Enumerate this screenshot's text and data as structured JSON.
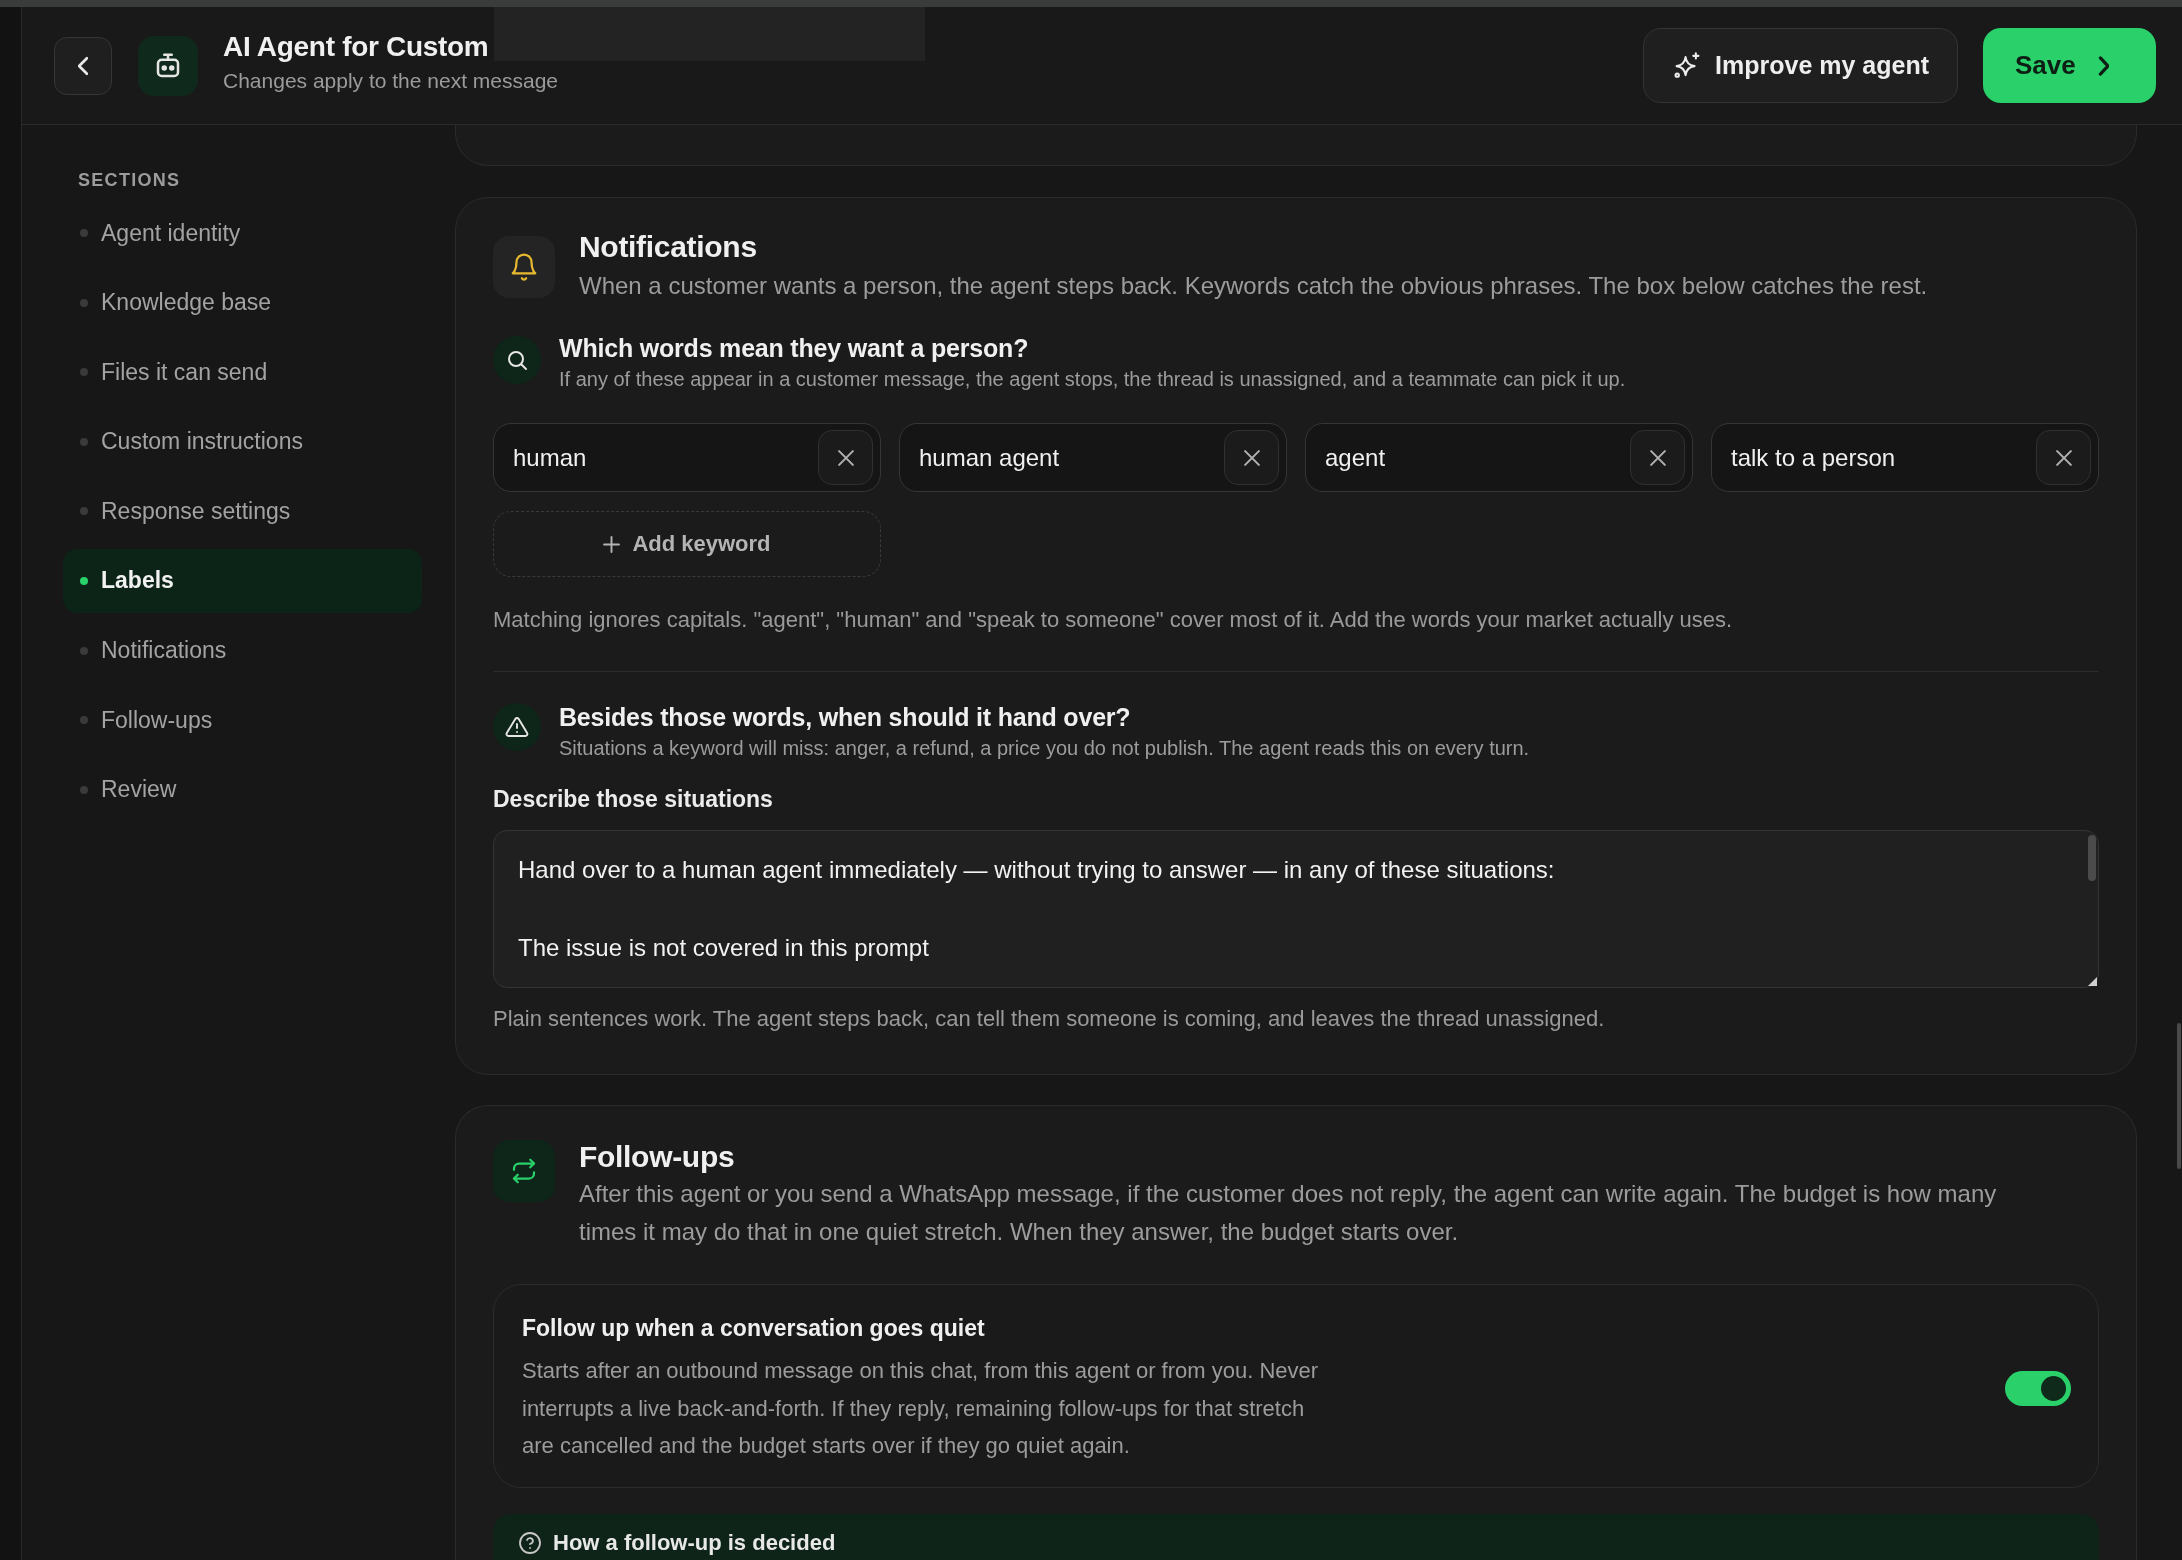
{
  "header": {
    "title": "AI Agent for Custom",
    "subtitle": "Changes apply to the next message",
    "buttons": [
      {
        "label": "Improve my agent",
        "kind": "secondary"
      },
      {
        "label": "Save",
        "kind": "primary"
      }
    ]
  },
  "sidebar": {
    "heading": "SECTIONS",
    "items": [
      {
        "label": "Agent identity",
        "selected": false
      },
      {
        "label": "Knowledge base",
        "selected": false
      },
      {
        "label": "Files it can send",
        "selected": false
      },
      {
        "label": "Custom instructions",
        "selected": false
      },
      {
        "label": "Response settings",
        "selected": false
      },
      {
        "label": "Labels",
        "selected": true
      },
      {
        "label": "Notifications",
        "selected": false
      },
      {
        "label": "Follow-ups",
        "selected": false
      },
      {
        "label": "Review",
        "selected": false
      }
    ]
  },
  "notifications": {
    "title": "Notifications",
    "description": "When a customer wants a person, the agent steps back. Keywords catch the obvious phrases. The box below catches the rest.",
    "keywords": {
      "title": "Which words mean they want a person?",
      "description": "If any of these appear in a customer message, the agent stops, the thread is unassigned, and a teammate can pick it up.",
      "items": [
        "human",
        "human agent",
        "agent",
        "talk to a person"
      ],
      "add_button": "Add keyword",
      "hint": "Matching ignores capitals. \"agent\", \"human\" and \"speak to someone\" cover most of it. Add the words your market actually uses."
    },
    "situations": {
      "title": "Besides those words, when should it hand over?",
      "description": "Situations a keyword will miss: anger, a refund, a price you do not publish. The agent reads this on every turn.",
      "field_label": "Describe those situations",
      "value": "Hand over to a human agent immediately — without trying to answer — in any of these situations:\n\nThe issue is not covered in this prompt",
      "hint": "Plain sentences work. The agent steps back, can tell them someone is coming, and leaves the thread unassigned."
    }
  },
  "follow_ups": {
    "title": "Follow-ups",
    "description": "After this agent or you send a WhatsApp message, if the customer does not reply, the agent can write again. The budget is how many times it may do that in one quiet stretch. When they answer, the budget starts over.",
    "setting": {
      "title": "Follow up when a conversation goes quiet",
      "description": "Starts after an outbound message on this chat, from this agent or from you. Never interrupts a live back-and-forth. If they reply, remaining follow-ups for that stretch are cancelled and the budget starts over if they go quiet again.",
      "on": true
    },
    "info_panel": {
      "title": "How a follow-up is decided"
    }
  }
}
